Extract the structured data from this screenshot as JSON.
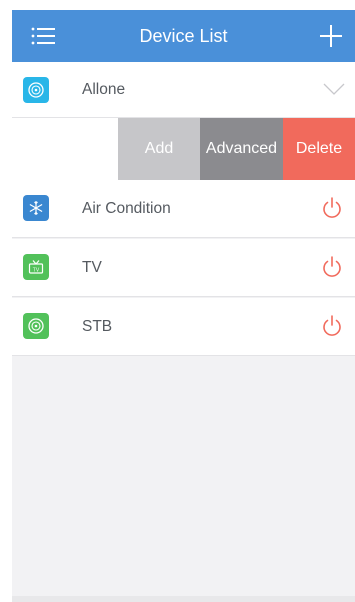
{
  "header": {
    "title": "Device List",
    "menu_icon": "list-icon",
    "add_icon": "plus-icon",
    "background": "#4a90d9"
  },
  "group": {
    "name": "Allone",
    "icon": "speaker-icon",
    "icon_color": "#29b6e8",
    "expand_icon": "chevron-down-icon"
  },
  "swipe_actions": {
    "add": "Add",
    "advanced": "Advanced",
    "delete": "Delete",
    "delete_color": "#f16a5c"
  },
  "devices": [
    {
      "name": "Air Condition",
      "icon": "snowflake-icon",
      "icon_color": "#3a87d0"
    },
    {
      "name": "TV",
      "icon": "tv-icon",
      "icon_color": "#52c15a"
    },
    {
      "name": "STB",
      "icon": "set-top-box-icon",
      "icon_color": "#52c15a"
    }
  ],
  "power_icon": "power-icon",
  "power_color": "#f16a5c"
}
